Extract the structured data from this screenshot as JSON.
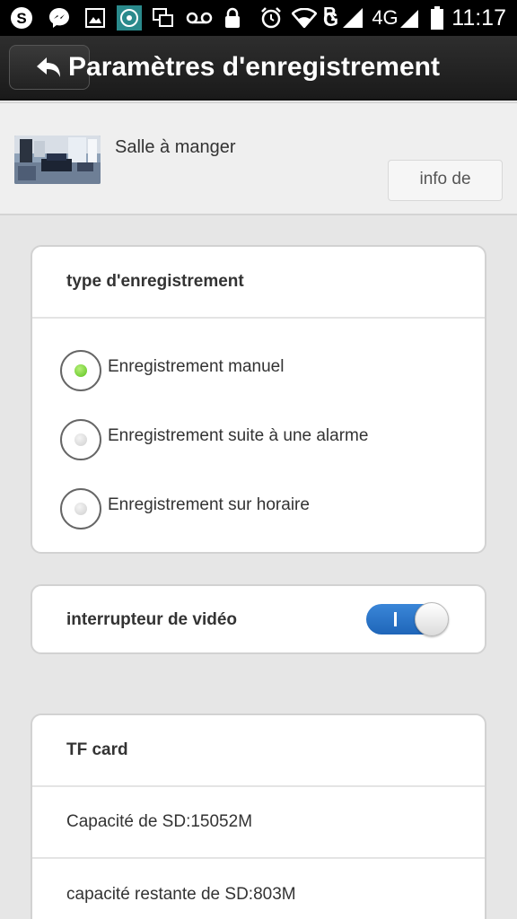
{
  "status_bar": {
    "time": "11:17",
    "network": "4G",
    "roaming": "R",
    "icons": [
      "skype-icon",
      "messenger-icon",
      "image-icon",
      "app-icon",
      "multiwindow-icon",
      "voicemail-icon",
      "lock-icon",
      "alarm-icon",
      "wifi-icon",
      "signal-icon",
      "signal-4g-icon",
      "battery-icon"
    ]
  },
  "app_bar": {
    "title": "Paramètres d'enregistrement",
    "back_icon": "back-arrow-icon"
  },
  "device": {
    "name": "Salle à manger",
    "info_button_label": "info de"
  },
  "recording_type": {
    "header": "type d'enregistrement",
    "options": [
      {
        "label": "Enregistrement manuel",
        "selected": true
      },
      {
        "label": "Enregistrement suite à une alarme",
        "selected": false
      },
      {
        "label": "Enregistrement sur horaire",
        "selected": false
      }
    ]
  },
  "video_switch": {
    "label": "interrupteur de vidéo",
    "enabled": true,
    "on_color": "#2a78cf"
  },
  "tf_card": {
    "header": "TF card",
    "capacity": "Capacité de SD:15052M",
    "remaining": "capacité restante de SD:803M"
  }
}
